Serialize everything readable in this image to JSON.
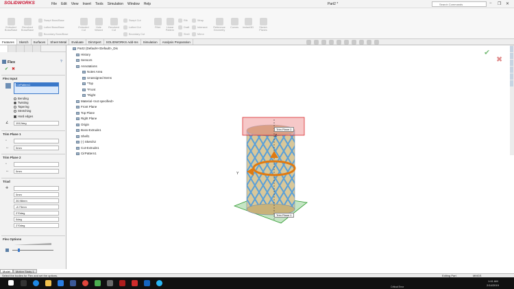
{
  "app": {
    "logo": "SOLIDWORKS",
    "doc_title": "Part2 *",
    "search_placeholder": "Search Commands",
    "minimize": "−",
    "restore": "❐",
    "close": "✕"
  },
  "menu": [
    "File",
    "Edit",
    "View",
    "Insert",
    "Tools",
    "Simulation",
    "Window",
    "Help"
  ],
  "toolbar": {
    "big": [
      "Extruded Boss/Base",
      "Revolved Boss/Base",
      "Extruded Cut",
      "Hole Wizard",
      "Revolved Cut",
      "Fillet",
      "Linear Pattern",
      "Rib",
      "Draft",
      "Shell",
      "Wrap",
      "Intersect",
      "Mirror",
      "Reference Geometry",
      "Curves",
      "Instant3D",
      "Sketch Planes"
    ],
    "small": [
      "Swept Boss/Base",
      "Lofted Boss/Base",
      "Boundary Boss/Base",
      "Swept Cut",
      "Lofted Cut",
      "Boundary Cut"
    ]
  },
  "tabs": [
    "Features",
    "Sketch",
    "Surfaces",
    "Sheet Metal",
    "Evaluate",
    "DimXpert",
    "SOLIDWORKS Add-Ins",
    "Simulation",
    "Analysis Preparation"
  ],
  "property_manager": {
    "title": "Flex",
    "help": "?",
    "ok": "✔",
    "cancel": "✖",
    "flex_input_label": "Flex Input",
    "flex_input_value": "CirPattern1",
    "options": [
      "Bending",
      "Twisting",
      "Tapering",
      "Stretching"
    ],
    "selected_option": "Twisting",
    "hard_edges": "Hard edges",
    "angle_value": "1512deg",
    "trim1_label": "Trim Plane 1",
    "trim1_value": "0mm",
    "trim2_label": "Trim Plane 2",
    "trim2_value": "0mm",
    "triad_label": "Triad",
    "triad_values": [
      "0mm",
      "26.98mm",
      "-8.73mm",
      "270deg",
      "0deg",
      "270deg"
    ],
    "flex_options_label": "Flex Options"
  },
  "tree": {
    "root": "Part2 (Default<<Default>_Dis",
    "items": [
      "History",
      "Sensors",
      "Annotations",
      "Notes Area",
      "Unassigned Items",
      "*Top",
      "*Front",
      "*Right",
      "Material <not specified>",
      "Front Plane",
      "Top Plane",
      "Right Plane",
      "Origin",
      "Boss-Extrude1",
      "Shell1",
      "(-) Sketch2",
      "Cut-Extrude1",
      "CirPattern1"
    ]
  },
  "viewport": {
    "trim_plane_2": "Trim Plane 2",
    "trim_plane_1": "Trim Plane 1",
    "axis_y": "Y",
    "axis_z": "Z"
  },
  "bottom_tabs": [
    "Model",
    "Motion Study 1"
  ],
  "status": {
    "message": "Select the bodies for Flex and set the options.",
    "mode": "Editing Part",
    "units": "MMGS"
  },
  "taskbar": {
    "time": "1:41 AM",
    "date": "2/14/2019",
    "system": "Critical Error"
  },
  "colors": {
    "accent": "#e07a10",
    "trim_red": "#d9262a",
    "trim_green": "#2e9a2e",
    "mesh": "#5aa0d8"
  }
}
